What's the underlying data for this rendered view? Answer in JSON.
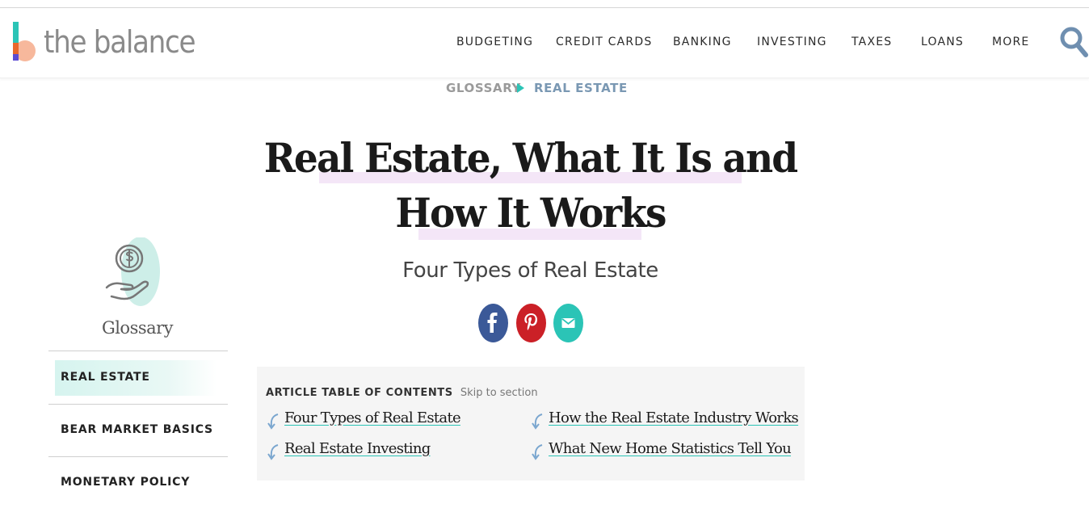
{
  "brand": {
    "name": "the balance"
  },
  "nav": {
    "items": [
      "BUDGETING",
      "CREDIT CARDS",
      "BANKING",
      "INVESTING",
      "TAXES",
      "LOANS",
      "MORE"
    ]
  },
  "breadcrumb": {
    "items": [
      "GLOSSARY",
      "REAL ESTATE"
    ]
  },
  "article": {
    "title_line1": "Real Estate, What It Is and",
    "title_line2": "How It Works",
    "subtitle": "Four Types of Real Estate"
  },
  "share": {
    "icons": [
      "facebook-icon",
      "pinterest-icon",
      "email-icon"
    ]
  },
  "sidebar": {
    "title": "Glossary",
    "items": [
      {
        "label": "REAL ESTATE",
        "active": true
      },
      {
        "label": "BEAR MARKET BASICS",
        "active": false
      },
      {
        "label": "MONETARY POLICY",
        "active": false
      }
    ]
  },
  "toc": {
    "heading": "ARTICLE TABLE OF CONTENTS",
    "skip": "Skip to section",
    "links": [
      "Four Types of Real Estate",
      "How the Real Estate Industry Works",
      "Real Estate Investing",
      "What New Home Statistics Tell You"
    ]
  },
  "colors": {
    "accent": "#2bc4b6",
    "facebook": "#3b5998",
    "pinterest": "#cb2027",
    "email": "#2bc4b6",
    "title_highlight": "#f4e6f7",
    "toc_background": "#f5f5f5",
    "toc_arrow": "#7aa6cf"
  }
}
